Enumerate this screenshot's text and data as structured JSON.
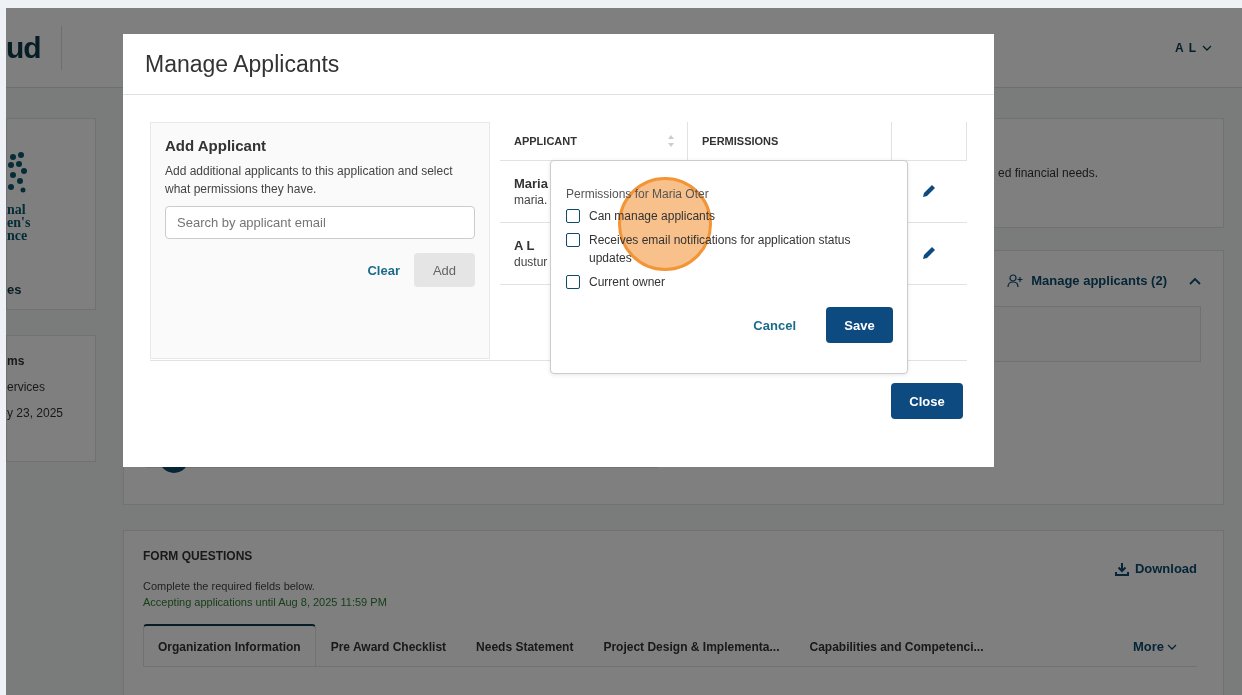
{
  "header": {
    "logo": "ud",
    "user": "A L"
  },
  "sidebar": {
    "org_card": {
      "logo_lines": [
        "nal",
        "en's",
        "nce"
      ],
      "link": "es"
    },
    "info_card": {
      "title": "ms",
      "lines": [
        "ervices",
        "y 23, 2025"
      ]
    }
  },
  "summary_card": {
    "text": "ed financial needs."
  },
  "applicants_card": {
    "button": "Manage applicants (2)",
    "expanded": true
  },
  "form_questions": {
    "title": "FORM QUESTIONS",
    "download": "Download",
    "instructions": "Complete the required fields below.",
    "deadline": "Accepting applications until Aug 8, 2025 11:59 PM",
    "tabs": [
      {
        "label": "Organization Information",
        "selected": true
      },
      {
        "label": "Pre Award Checklist",
        "selected": false
      },
      {
        "label": "Needs Statement",
        "selected": false
      },
      {
        "label": "Project Design & Implementa...",
        "selected": false
      },
      {
        "label": "Capabilities and Competenci...",
        "selected": false
      }
    ],
    "more": "More"
  },
  "modal": {
    "title": "Manage Applicants",
    "add_panel": {
      "title": "Add Applicant",
      "description": "Add additional applicants to this application and select what permissions they have.",
      "search": {
        "placeholder": "Search by applicant email"
      },
      "clear": "Clear",
      "add": {
        "label": "Add",
        "disabled": true
      }
    },
    "table": {
      "columns": [
        "APPLICANT",
        "PERMISSIONS"
      ],
      "rows": [
        {
          "name": "Maria",
          "email": "maria."
        },
        {
          "name": "A L",
          "email": "dustur"
        }
      ]
    },
    "popover": {
      "title": "Permissions for Maria Oter",
      "options": [
        {
          "label": "Can manage applicants",
          "checked": false
        },
        {
          "label": "Receives email notifications for application status updates",
          "checked": false
        },
        {
          "label": "Current owner",
          "checked": false
        }
      ],
      "cancel": "Cancel",
      "save": "Save"
    },
    "close": "Close"
  }
}
